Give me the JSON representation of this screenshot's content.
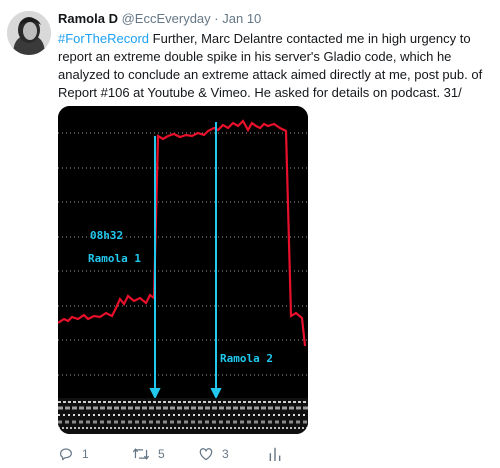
{
  "tweet": {
    "author_name": "Ramola D",
    "handle": "@EccEveryday",
    "separator": "·",
    "date": "Jan 10",
    "hashtag": "#ForTheRecord",
    "text": " Further, Marc Delantre contacted me in high urgency to report an extreme double spike in his server's Gladio code, which he analyzed to conclude an extreme attack aimed directly at me, post pub. of Report #106 at Youtube & Vimeo. He asked for details on podcast. 31/"
  },
  "media": {
    "label_time": "08h32",
    "label_1": "Ramola 1",
    "label_2": "Ramola 2",
    "colors": {
      "line": "#e8102a",
      "annotation": "#22c8ee",
      "grid": "#9a9a9a",
      "background": "#000000"
    }
  },
  "actions": {
    "reply_count": "1",
    "retweet_count": "5",
    "like_count": "3",
    "icons": [
      "reply-icon",
      "retweet-icon",
      "like-icon",
      "analytics-icon"
    ]
  }
}
